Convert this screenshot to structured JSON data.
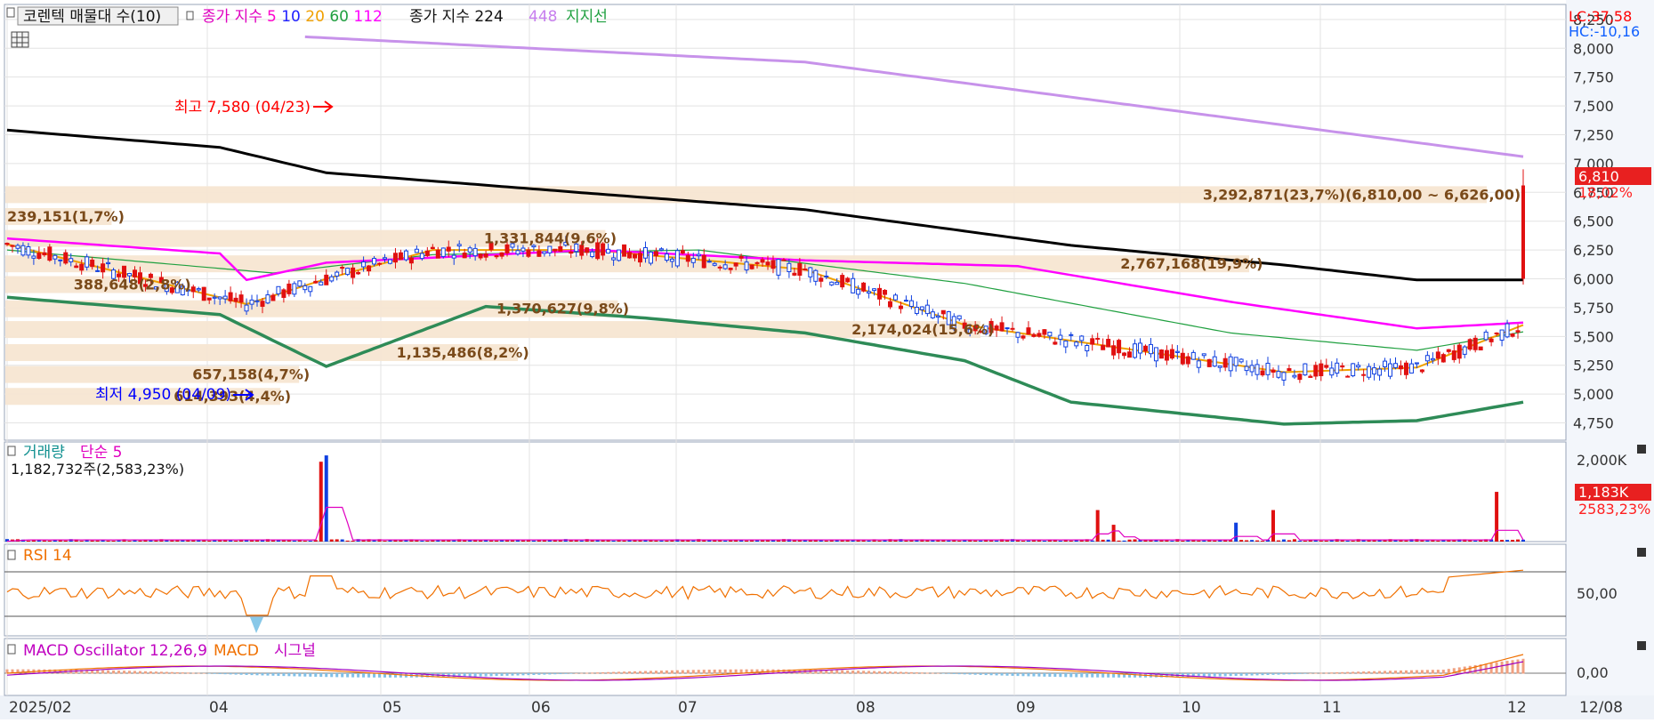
{
  "chart_data": {
    "type": "candlestick",
    "x_ticks": [
      "2025/02",
      "04",
      "05",
      "06",
      "07",
      "08",
      "09",
      "10",
      "11",
      "12",
      "12/08"
    ],
    "price_panel": {
      "legend": {
        "title": "코렌텍 매물대 수(10)",
        "ma_label": "종가 지수",
        "ma_periods": [
          {
            "text": "5",
            "color": "#ff00cc"
          },
          {
            "text": "10",
            "color": "#2020ff"
          },
          {
            "text": "20",
            "color": "#f0a000"
          },
          {
            "text": "60",
            "color": "#20a040"
          },
          {
            "text": "112",
            "color": "#ff00ff"
          }
        ],
        "ma2_label": "종가 지수 224",
        "ma3_label": "448",
        "support_label": "지지선"
      },
      "ylim": [
        4600,
        8380
      ],
      "y_ticks": [
        "4,750",
        "5,000",
        "5,250",
        "5,500",
        "5,750",
        "6,000",
        "6,250",
        "6,500",
        "6,750",
        "7,000",
        "7,250",
        "7,500",
        "7,750",
        "8,000",
        "8,250"
      ],
      "lc_label": "LC:37,58",
      "hc_label": "HC:-10,16",
      "current_price": "6,810",
      "change_pct": "18,02%",
      "high_label": "최고 7,580 (04/23)",
      "low_label": "최저 4,950 (04/09)",
      "volume_profile": [
        {
          "text": "3,292,871(23,7%)(6,810,00 ~ 6,626,00)",
          "price": 6730,
          "pct": 23.7
        },
        {
          "text": "239,151(1,7%)",
          "price": 6540,
          "pct": 1.7
        },
        {
          "text": "1,331,844(9,6%)",
          "price": 6350,
          "pct": 9.6
        },
        {
          "text": "2,767,168(19,9%)",
          "price": 6130,
          "pct": 19.9
        },
        {
          "text": "388,648(2,8%)",
          "price": 5950,
          "pct": 2.8
        },
        {
          "text": "1,370,627(9,8%)",
          "price": 5740,
          "pct": 9.8
        },
        {
          "text": "2,174,024(15,6%)",
          "price": 5560,
          "pct": 15.6
        },
        {
          "text": "1,135,486(8,2%)",
          "price": 5360,
          "pct": 8.2
        },
        {
          "text": "657,158(4,7%)",
          "price": 5170,
          "pct": 4.7
        },
        {
          "text": "614,393(4,4%)",
          "price": 4980,
          "pct": 4.4
        }
      ],
      "ma448_line": [
        [
          0,
          8230
        ],
        [
          150,
          7880
        ],
        [
          285,
          7060
        ]
      ],
      "ma224_line": [
        [
          0,
          7290
        ],
        [
          40,
          7140
        ],
        [
          60,
          6920
        ],
        [
          110,
          6740
        ],
        [
          150,
          6600
        ],
        [
          200,
          6290
        ],
        [
          240,
          6120
        ],
        [
          265,
          5990
        ],
        [
          285,
          5990
        ]
      ],
      "ma112_line": [
        [
          0,
          6350
        ],
        [
          40,
          6220
        ],
        [
          45,
          5990
        ],
        [
          60,
          6140
        ],
        [
          110,
          6250
        ],
        [
          150,
          6160
        ],
        [
          190,
          6110
        ],
        [
          230,
          5800
        ],
        [
          265,
          5570
        ],
        [
          285,
          5620
        ]
      ],
      "ma60_line": [
        [
          0,
          6250
        ],
        [
          50,
          6050
        ],
        [
          80,
          6210
        ],
        [
          130,
          6250
        ],
        [
          180,
          5960
        ],
        [
          230,
          5530
        ],
        [
          265,
          5380
        ],
        [
          285,
          5540
        ]
      ],
      "ma20_line": [
        [
          0,
          6300
        ],
        [
          45,
          5780
        ],
        [
          60,
          6000
        ],
        [
          80,
          6250
        ],
        [
          110,
          6250
        ],
        [
          150,
          6080
        ],
        [
          180,
          5600
        ],
        [
          240,
          5190
        ],
        [
          265,
          5230
        ],
        [
          285,
          5600
        ]
      ],
      "support_line": [
        [
          0,
          5840
        ],
        [
          40,
          5690
        ],
        [
          60,
          5240
        ],
        [
          90,
          5760
        ],
        [
          120,
          5660
        ],
        [
          150,
          5530
        ],
        [
          180,
          5290
        ],
        [
          200,
          4930
        ],
        [
          240,
          4740
        ],
        [
          265,
          4770
        ],
        [
          285,
          4930
        ]
      ],
      "candles_hint": "approximate daily candles from 2025/02 to 12/08"
    },
    "volume_panel": {
      "title": "거래량",
      "ma_label": "단순 5",
      "info": "1,182,732주(2,583,23%)",
      "y_tick": "2,000K",
      "current_label": "1,183K",
      "current_pct": "2583,23%",
      "spikes": [
        [
          59,
          1900
        ],
        [
          60,
          2050
        ],
        [
          205,
          750
        ],
        [
          208,
          400
        ],
        [
          231,
          450
        ],
        [
          238,
          750
        ],
        [
          280,
          1183
        ]
      ]
    },
    "rsi_panel": {
      "title": "RSI 14",
      "y_tick": "50,00",
      "levels": [
        70,
        30
      ],
      "current": 78
    },
    "macd_panel": {
      "title": "MACD Oscillator 12,26,9",
      "macd_label": "MACD",
      "signal_label": "시그널",
      "y_tick": "0,00"
    }
  }
}
